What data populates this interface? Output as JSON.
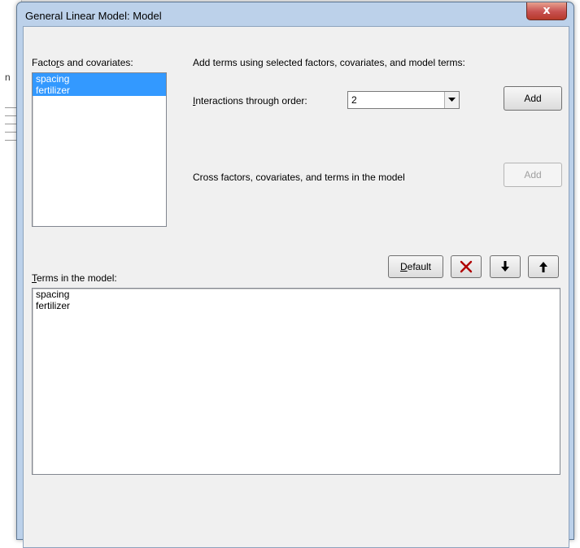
{
  "dialog": {
    "title": "General Linear Model: Model",
    "close_glyph": "x"
  },
  "factors": {
    "label": "Factors and covariates:",
    "items": [
      "spacing",
      "fertilizer"
    ]
  },
  "add_terms_label": "Add terms using selected factors, covariates, and model terms:",
  "interactions": {
    "label": "Interactions through order:",
    "value": "2",
    "add_label": "Add"
  },
  "cross": {
    "label": "Cross factors, covariates, and terms in the model",
    "add_label": "Add"
  },
  "terms": {
    "label": "Terms in the model:",
    "default_label": "Default",
    "items": [
      "spacing",
      "fertilizer"
    ]
  },
  "icons": {
    "delete": "delete-x-icon",
    "move_down": "arrow-down-icon",
    "move_up": "arrow-up-icon",
    "delete_color": "#b00000"
  }
}
